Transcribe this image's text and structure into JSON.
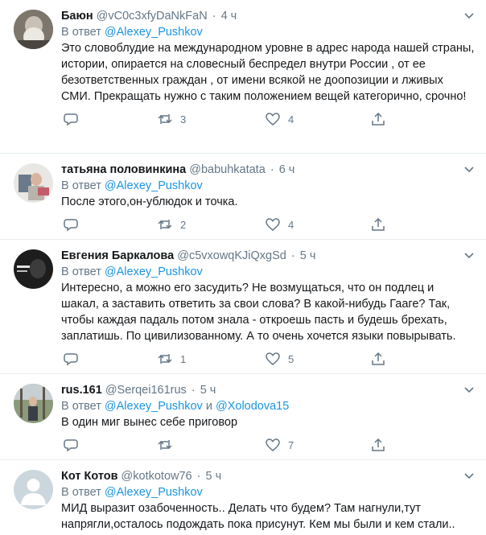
{
  "tweets": [
    {
      "name": "Баюн",
      "handle": "@vC0c3xfyDaNkFaN",
      "time": "4 ч",
      "reply_prefix": "В ответ",
      "mentions": [
        "@Alexey_Pushkov"
      ],
      "mention_joiner": "",
      "text": "Это словоблудие на международном уровне в адрес  народа нашей страны, истории, опирается на словесный беспредел внутри России , от ее безответственных граждан , от имени всякой не доопозиции и лживых  СМИ. Прекращать нужно с таким положением вещей категорично, срочно!",
      "retweets": "3",
      "likes": "4",
      "replies": ""
    },
    {
      "name": "татьяна половинкина",
      "handle": "@babuhkatata",
      "time": "6 ч",
      "reply_prefix": "В ответ",
      "mentions": [
        "@Alexey_Pushkov"
      ],
      "mention_joiner": "",
      "text": "После этого,он-ублюдок и точка.",
      "retweets": "2",
      "likes": "4",
      "replies": ""
    },
    {
      "name": "Евгения Баркалова",
      "handle": "@c5vxowqKJiQxgSd",
      "time": "5 ч",
      "reply_prefix": "В ответ",
      "mentions": [
        "@Alexey_Pushkov"
      ],
      "mention_joiner": "",
      "text": "Интересно, а можно его засудить? Не возмущаться, что он подлец и шакал, а заставить ответить за свои слова? В какой-нибудь Гааге? Так, чтобы каждая падаль потом знала - откроешь пасть и будешь брехать, заплатишь. По цивилизованному. А то очень хочется языки повырывать.",
      "retweets": "1",
      "likes": "5",
      "replies": ""
    },
    {
      "name": "rus.161",
      "handle": "@Serqei161rus",
      "time": "5 ч",
      "reply_prefix": "В ответ",
      "mentions": [
        "@Alexey_Pushkov",
        "@Xolodova15"
      ],
      "mention_joiner": "и",
      "text": "В один миг вынес себе приговор",
      "retweets": "",
      "likes": "7",
      "replies": ""
    },
    {
      "name": "Кот Котов",
      "handle": "@kotkotow76",
      "time": "5 ч",
      "reply_prefix": "В ответ",
      "mentions": [
        "@Alexey_Pushkov"
      ],
      "mention_joiner": "",
      "text": "МИД выразит озабоченность.. Делать что будем? Там нагнули,тут напрягли,осталось подождать пока присунут. Кем мы были и кем стали..",
      "retweets": "",
      "likes": "",
      "replies": ""
    }
  ],
  "colors": {
    "text": "#14171a",
    "secondary": "#657786",
    "link": "#1b95e0",
    "divider": "#e6ecf0"
  },
  "icons": {
    "reply": "reply-icon",
    "retweet": "retweet-icon",
    "like": "heart-icon",
    "share": "share-icon",
    "menu": "chevron-down-icon"
  }
}
